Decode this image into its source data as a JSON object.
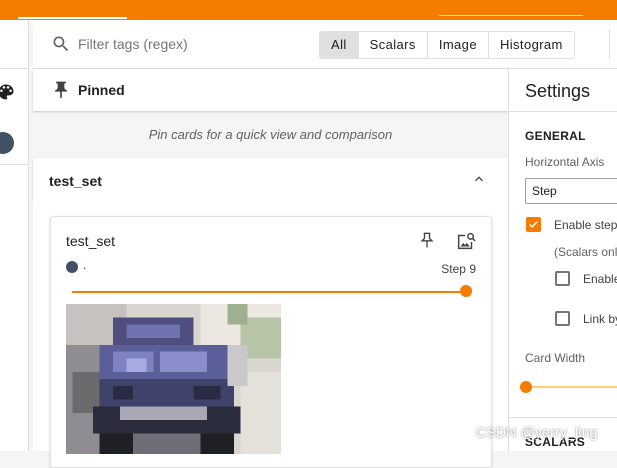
{
  "colors": {
    "accent": "#f57c00",
    "run_color": "#425066"
  },
  "header": {
    "toolbar_tabs_underlined": true
  },
  "left_rail": {
    "icons": [
      "palette-icon",
      "run-color-dot-icon"
    ]
  },
  "filter": {
    "placeholder": "Filter tags (regex)",
    "tabs": [
      {
        "label": "All",
        "active": true
      },
      {
        "label": "Scalars",
        "active": false
      },
      {
        "label": "Image",
        "active": false
      },
      {
        "label": "Histogram",
        "active": false
      }
    ]
  },
  "pinned": {
    "title": "Pinned",
    "empty_message": "Pin cards for a quick view and comparison"
  },
  "group": {
    "title": "test_set",
    "card": {
      "title": "test_set",
      "run_label": ".",
      "step_label": "Step 9",
      "step_fraction": 1.0
    }
  },
  "settings": {
    "title": "Settings",
    "general_heading": "GENERAL",
    "horizontal_axis_label": "Horizontal Axis",
    "horizontal_axis_value": "Step",
    "enable_step_label": "Enable step",
    "enable_step_checked": true,
    "scalars_only_note": "(Scalars onl",
    "enable_label": "Enable",
    "enable_checked": false,
    "link_label": "Link by",
    "link_checked": false,
    "card_width_label": "Card Width",
    "card_width_fraction": 0.0,
    "scalars_heading": "SCALARS"
  },
  "watermark": "CSDN @yerry_ling"
}
